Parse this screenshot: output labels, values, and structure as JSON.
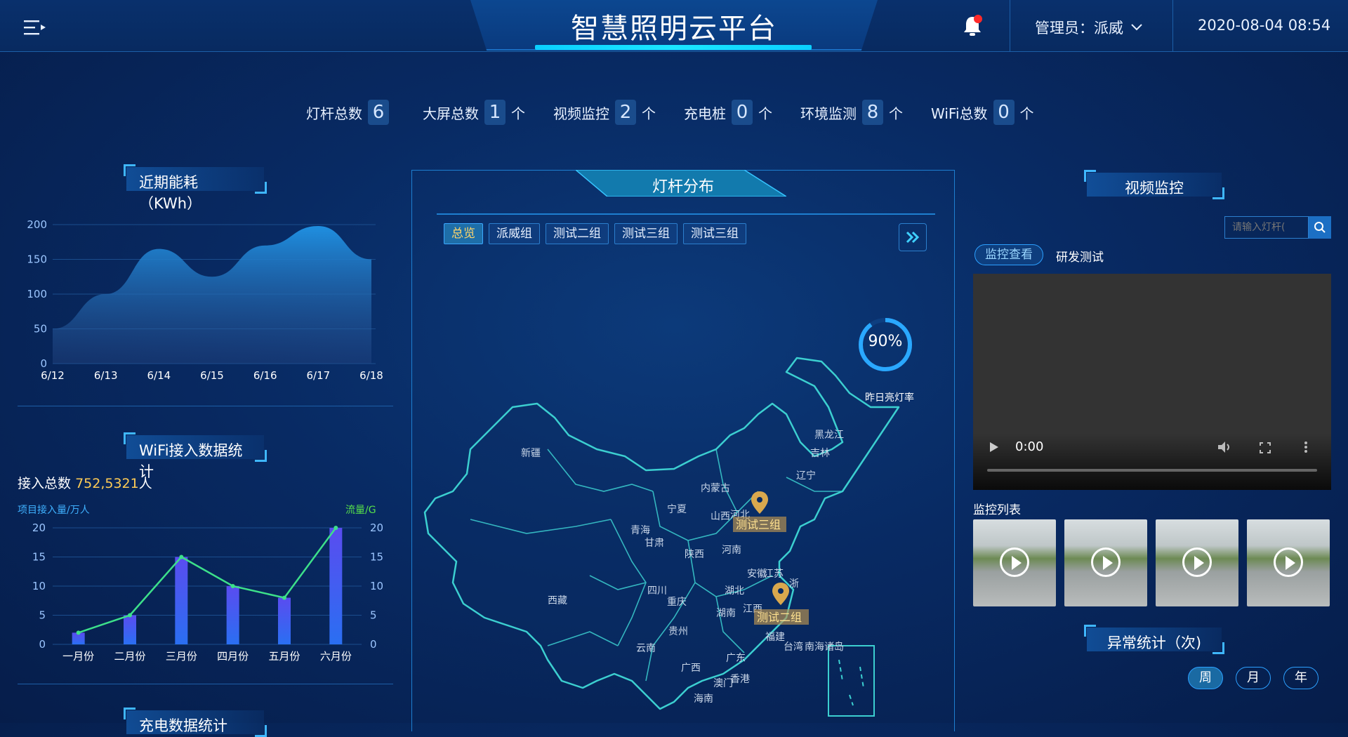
{
  "header": {
    "title": "智慧照明云平台",
    "admin_label": "管理员：派威",
    "datetime": "2020-08-04 08:54"
  },
  "counts": [
    {
      "label": "灯杆总数",
      "value": "6",
      "unit": ""
    },
    {
      "label": "大屏总数",
      "value": "1",
      "unit": "个"
    },
    {
      "label": "视频监控",
      "value": "2",
      "unit": "个"
    },
    {
      "label": "充电桩",
      "value": "0",
      "unit": "个"
    },
    {
      "label": "环境监测",
      "value": "8",
      "unit": "个"
    },
    {
      "label": "WiFi总数",
      "value": "0",
      "unit": "个"
    }
  ],
  "energy": {
    "title": "近期能耗（KWh）"
  },
  "wifi": {
    "title": "WiFi接入数据统计",
    "total_label": "接入总数",
    "total_value": "752,5321",
    "total_unit": "人",
    "left_axis_label": "项目接入量/万人",
    "right_axis_label": "流量/G"
  },
  "charge": {
    "title": "充电数据统计"
  },
  "map": {
    "title": "灯杆分布",
    "tabs": [
      "总览",
      "派威组",
      "测试二组",
      "测试三组",
      "测试三组"
    ],
    "rate_value": "90%",
    "rate_label": "昨日亮灯率",
    "rate": 0.9,
    "provinces": [
      "新疆",
      "西藏",
      "青海",
      "甘肃",
      "宁夏",
      "内蒙古",
      "山西",
      "河北",
      "陕西",
      "河南",
      "四川",
      "重庆",
      "湖北",
      "安徽",
      "江苏",
      "浙",
      "湖南",
      "江西",
      "贵州",
      "云南",
      "广西",
      "广东",
      "福建",
      "台湾",
      "南海诸岛",
      "黑龙江",
      "吉林",
      "辽宁",
      "澳门",
      "香港",
      "海南"
    ],
    "markers": [
      "测试三组",
      "测试二组"
    ]
  },
  "video": {
    "title": "视频监控",
    "search_placeholder": "请输入灯杆(",
    "tab_active": "监控查看",
    "tab_other": "研发测试",
    "time": "0:00",
    "list_label": "监控列表"
  },
  "abnormal": {
    "title": "异常统计（次)",
    "periods": [
      "周",
      "月",
      "年"
    ]
  },
  "chart_data": [
    {
      "type": "area",
      "x": [
        "6/12",
        "6/13",
        "6/14",
        "6/15",
        "6/16",
        "6/17",
        "6/18"
      ],
      "values": [
        50,
        100,
        165,
        125,
        170,
        198,
        150
      ],
      "ylim": [
        0,
        200
      ],
      "yticks": [
        "0",
        "50",
        "100",
        "150",
        "200"
      ],
      "color": "#1f8fe0"
    },
    {
      "type": "bar",
      "categories": [
        "一月份",
        "二月份",
        "三月份",
        "四月份",
        "五月份",
        "六月份"
      ],
      "series": [
        {
          "values": [
            2,
            5,
            15,
            10,
            8,
            20
          ],
          "color": "#5a4cf0"
        },
        {
          "values": [
            2,
            5,
            15,
            10,
            8,
            20
          ],
          "color": "#3de08a"
        }
      ],
      "ylim": [
        0,
        20
      ],
      "yticks_left": [
        "0",
        "5",
        "10",
        "15",
        "20"
      ],
      "yticks_right": [
        "0",
        "5",
        "10",
        "15",
        "20"
      ]
    }
  ]
}
